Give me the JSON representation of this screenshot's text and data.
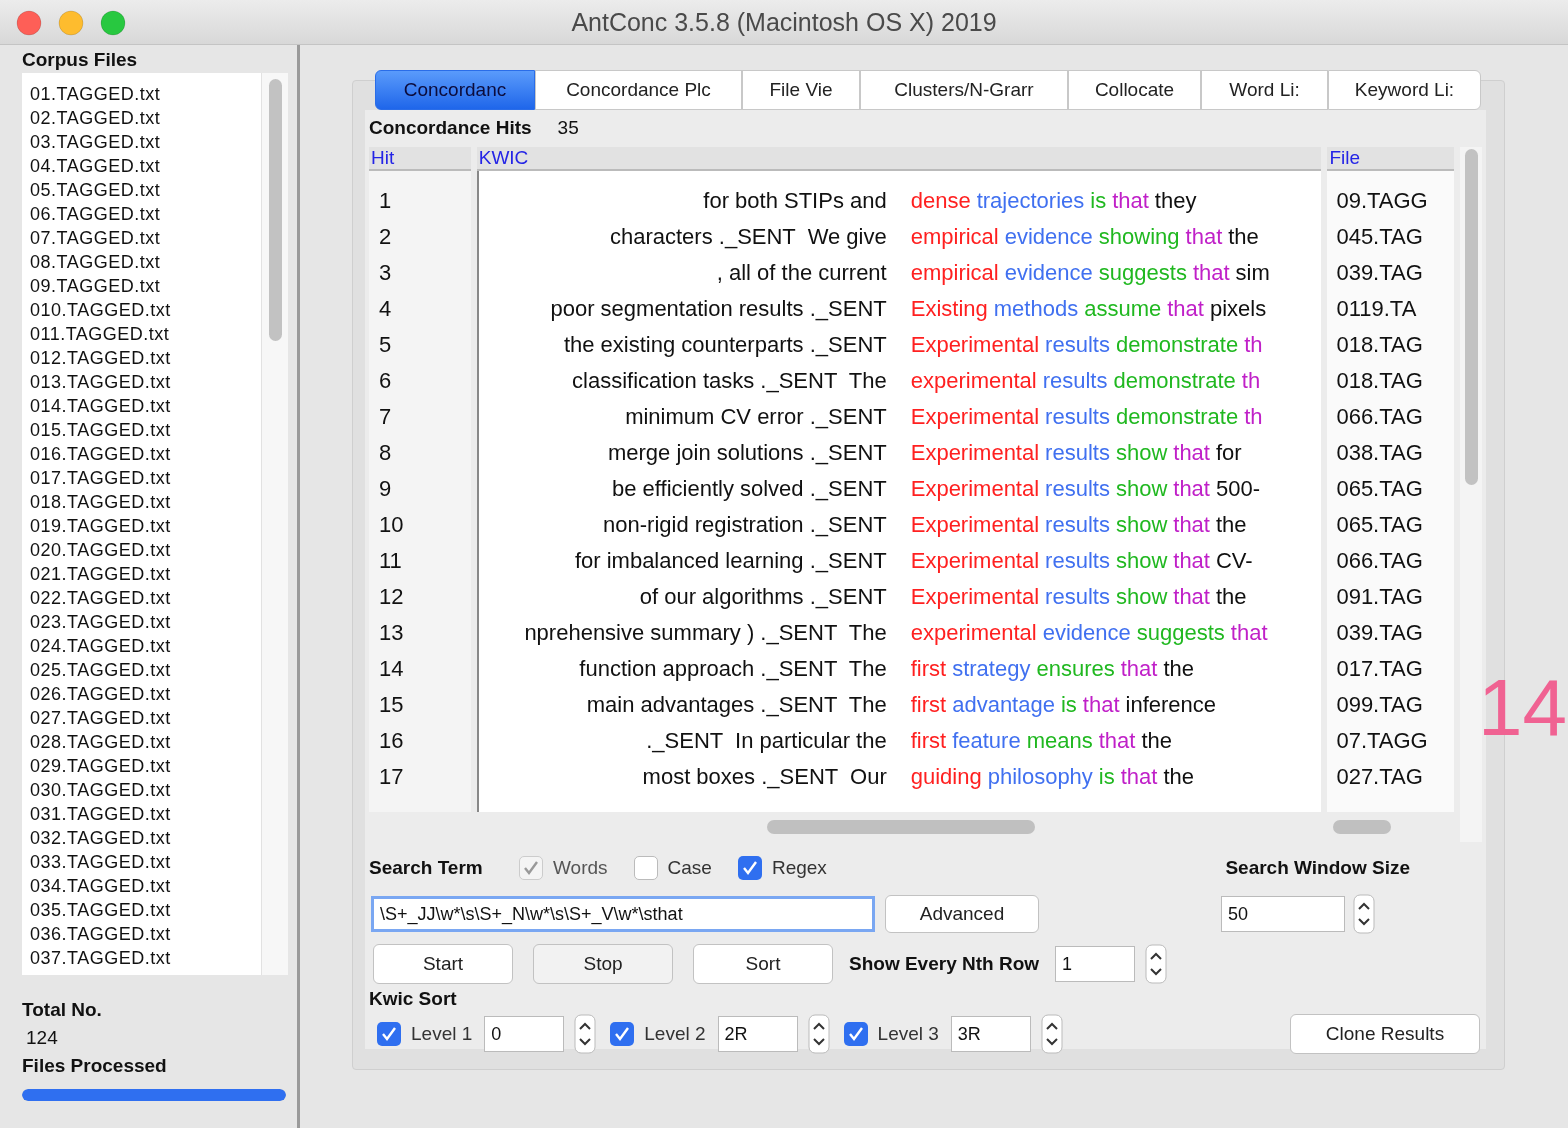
{
  "window": {
    "title": "AntConc 3.5.8 (Macintosh OS X) 2019"
  },
  "corpus_files": {
    "heading": "Corpus Files",
    "files": [
      "01.TAGGED.txt",
      "02.TAGGED.txt",
      "03.TAGGED.txt",
      "04.TAGGED.txt",
      "05.TAGGED.txt",
      "06.TAGGED.txt",
      "07.TAGGED.txt",
      "08.TAGGED.txt",
      "09.TAGGED.txt",
      "010.TAGGED.txt",
      "011.TAGGED.txt",
      "012.TAGGED.txt",
      "013.TAGGED.txt",
      "014.TAGGED.txt",
      "015.TAGGED.txt",
      "016.TAGGED.txt",
      "017.TAGGED.txt",
      "018.TAGGED.txt",
      "019.TAGGED.txt",
      "020.TAGGED.txt",
      "021.TAGGED.txt",
      "022.TAGGED.txt",
      "023.TAGGED.txt",
      "024.TAGGED.txt",
      "025.TAGGED.txt",
      "026.TAGGED.txt",
      "027.TAGGED.txt",
      "028.TAGGED.txt",
      "029.TAGGED.txt",
      "030.TAGGED.txt",
      "031.TAGGED.txt",
      "032.TAGGED.txt",
      "033.TAGGED.txt",
      "034.TAGGED.txt",
      "035.TAGGED.txt",
      "036.TAGGED.txt",
      "037.TAGGED.txt"
    ],
    "total_label": "Total No.",
    "total": "124",
    "processed_label": "Files Processed",
    "progress": {
      "level": 1
    }
  },
  "tabs": [
    {
      "label": "Concordanc",
      "selected": true
    },
    {
      "label": "Concordance Plc",
      "selected": false
    },
    {
      "label": "File Vie",
      "selected": false
    },
    {
      "label": "Clusters/N-Grarr",
      "selected": false
    },
    {
      "label": "Collocate",
      "selected": false
    },
    {
      "label": "Word Li:",
      "selected": false
    },
    {
      "label": "Keyword Li:",
      "selected": false
    }
  ],
  "hits": {
    "label": "Concordance Hits",
    "count": "35"
  },
  "table": {
    "columns": [
      "Hit",
      "KWIC",
      "File"
    ],
    "rows": [
      {
        "hit": "1",
        "left": "for both STIPs and",
        "right": [
          {
            "text": "dense",
            "color": "#ff2020"
          },
          {
            "text": "trajectories",
            "color": "#4070f0"
          },
          {
            "text": "is",
            "color": "#20b820"
          },
          {
            "text": "that",
            "color": "#c020c8"
          },
          {
            "text": "they",
            "color": "#101010"
          }
        ],
        "file": "09.TAGG"
      },
      {
        "hit": "2",
        "left": "characters ._SENT  We give",
        "right": [
          {
            "text": "empirical",
            "color": "#ff2020"
          },
          {
            "text": "evidence",
            "color": "#4070f0"
          },
          {
            "text": "showing",
            "color": "#20b820"
          },
          {
            "text": "that",
            "color": "#c020c8"
          },
          {
            "text": "the",
            "color": "#101010"
          }
        ],
        "file": "045.TAG"
      },
      {
        "hit": "3",
        "left": ", all of the current",
        "right": [
          {
            "text": "empirical",
            "color": "#ff2020"
          },
          {
            "text": "evidence",
            "color": "#4070f0"
          },
          {
            "text": "suggests",
            "color": "#20b820"
          },
          {
            "text": "that",
            "color": "#c020c8"
          },
          {
            "text": "sim",
            "color": "#101010"
          }
        ],
        "file": "039.TAG"
      },
      {
        "hit": "4",
        "left": "poor segmentation results ._SENT",
        "right": [
          {
            "text": "Existing",
            "color": "#ff2020"
          },
          {
            "text": "methods",
            "color": "#4070f0"
          },
          {
            "text": "assume",
            "color": "#20b820"
          },
          {
            "text": "that",
            "color": "#c020c8"
          },
          {
            "text": "pixels",
            "color": "#101010"
          }
        ],
        "file": "0119.TA"
      },
      {
        "hit": "5",
        "left": "the existing counterparts ._SENT",
        "right": [
          {
            "text": "Experimental",
            "color": "#ff2020"
          },
          {
            "text": "results",
            "color": "#4070f0"
          },
          {
            "text": "demonstrate",
            "color": "#20b820"
          },
          {
            "text": "th",
            "color": "#c020c8"
          }
        ],
        "file": "018.TAG"
      },
      {
        "hit": "6",
        "left": "classification tasks ._SENT  The",
        "right": [
          {
            "text": "experimental",
            "color": "#ff2020"
          },
          {
            "text": "results",
            "color": "#4070f0"
          },
          {
            "text": "demonstrate",
            "color": "#20b820"
          },
          {
            "text": "th",
            "color": "#c020c8"
          }
        ],
        "file": "018.TAG"
      },
      {
        "hit": "7",
        "left": "minimum CV error ._SENT",
        "right": [
          {
            "text": "Experimental",
            "color": "#ff2020"
          },
          {
            "text": "results",
            "color": "#4070f0"
          },
          {
            "text": "demonstrate",
            "color": "#20b820"
          },
          {
            "text": "th",
            "color": "#c020c8"
          }
        ],
        "file": "066.TAG"
      },
      {
        "hit": "8",
        "left": "merge join solutions ._SENT",
        "right": [
          {
            "text": "Experimental",
            "color": "#ff2020"
          },
          {
            "text": "results",
            "color": "#4070f0"
          },
          {
            "text": "show",
            "color": "#20b820"
          },
          {
            "text": "that",
            "color": "#c020c8"
          },
          {
            "text": "for",
            "color": "#101010"
          }
        ],
        "file": "038.TAG"
      },
      {
        "hit": "9",
        "left": "be efficiently solved ._SENT",
        "right": [
          {
            "text": "Experimental",
            "color": "#ff2020"
          },
          {
            "text": "results",
            "color": "#4070f0"
          },
          {
            "text": "show",
            "color": "#20b820"
          },
          {
            "text": "that",
            "color": "#c020c8"
          },
          {
            "text": "500-",
            "color": "#101010"
          }
        ],
        "file": "065.TAG"
      },
      {
        "hit": "10",
        "left": "non-rigid registration ._SENT",
        "right": [
          {
            "text": "Experimental",
            "color": "#ff2020"
          },
          {
            "text": "results",
            "color": "#4070f0"
          },
          {
            "text": "show",
            "color": "#20b820"
          },
          {
            "text": "that",
            "color": "#c020c8"
          },
          {
            "text": "the",
            "color": "#101010"
          }
        ],
        "file": "065.TAG"
      },
      {
        "hit": "11",
        "left": "for imbalanced learning ._SENT",
        "right": [
          {
            "text": "Experimental",
            "color": "#ff2020"
          },
          {
            "text": "results",
            "color": "#4070f0"
          },
          {
            "text": "show",
            "color": "#20b820"
          },
          {
            "text": "that",
            "color": "#c020c8"
          },
          {
            "text": "CV-",
            "color": "#101010"
          }
        ],
        "file": "066.TAG"
      },
      {
        "hit": "12",
        "left": "of our algorithms ._SENT",
        "right": [
          {
            "text": "Experimental",
            "color": "#ff2020"
          },
          {
            "text": "results",
            "color": "#4070f0"
          },
          {
            "text": "show",
            "color": "#20b820"
          },
          {
            "text": "that",
            "color": "#c020c8"
          },
          {
            "text": "the",
            "color": "#101010"
          }
        ],
        "file": "091.TAG"
      },
      {
        "hit": "13",
        "left": "nprehensive summary ) ._SENT  The",
        "right": [
          {
            "text": "experimental",
            "color": "#ff2020"
          },
          {
            "text": "evidence",
            "color": "#4070f0"
          },
          {
            "text": "suggests",
            "color": "#20b820"
          },
          {
            "text": "that",
            "color": "#c020c8"
          }
        ],
        "file": "039.TAG"
      },
      {
        "hit": "14",
        "left": "function approach ._SENT  The",
        "right": [
          {
            "text": "first",
            "color": "#ff2020"
          },
          {
            "text": "strategy",
            "color": "#4070f0"
          },
          {
            "text": "ensures",
            "color": "#20b820"
          },
          {
            "text": "that",
            "color": "#c020c8"
          },
          {
            "text": "the",
            "color": "#101010"
          }
        ],
        "file": "017.TAG"
      },
      {
        "hit": "15",
        "left": "main advantages ._SENT  The",
        "right": [
          {
            "text": "first",
            "color": "#ff2020"
          },
          {
            "text": "advantage",
            "color": "#4070f0"
          },
          {
            "text": "is",
            "color": "#20b820"
          },
          {
            "text": "that",
            "color": "#c020c8"
          },
          {
            "text": "inference",
            "color": "#101010"
          }
        ],
        "file": "099.TAG"
      },
      {
        "hit": "16",
        "left": "._SENT  In particular the",
        "right": [
          {
            "text": "first",
            "color": "#ff2020"
          },
          {
            "text": "feature",
            "color": "#4070f0"
          },
          {
            "text": "means",
            "color": "#20b820"
          },
          {
            "text": "that",
            "color": "#c020c8"
          },
          {
            "text": "the",
            "color": "#101010"
          }
        ],
        "file": "07.TAGG"
      },
      {
        "hit": "17",
        "left": "most boxes ._SENT  Our",
        "right": [
          {
            "text": "guiding",
            "color": "#ff2020"
          },
          {
            "text": "philosophy",
            "color": "#4070f0"
          },
          {
            "text": "is",
            "color": "#20b820"
          },
          {
            "text": "that",
            "color": "#c020c8"
          },
          {
            "text": "the",
            "color": "#101010"
          }
        ],
        "file": "027.TAG"
      }
    ]
  },
  "search": {
    "label": "Search Term",
    "options": [
      {
        "label": "Words",
        "checked": true,
        "disabled": true
      },
      {
        "label": "Case",
        "checked": false,
        "disabled": false
      },
      {
        "label": "Regex",
        "checked": true,
        "disabled": false
      }
    ],
    "value": "\\S+_JJ\\w*\\s\\S+_N\\w*\\s\\S+_V\\w*\\sthat",
    "advanced": "Advanced"
  },
  "window_size": {
    "label": "Search Window Size",
    "value": "50"
  },
  "buttons": [
    {
      "label": "Start",
      "disabled": false
    },
    {
      "label": "Stop",
      "disabled": true
    },
    {
      "label": "Sort",
      "disabled": false
    }
  ],
  "nth_row": {
    "label": "Show Every Nth Row",
    "value": "1"
  },
  "kwic_sort": {
    "label": "Kwic Sort",
    "levels": [
      {
        "label": "Level 1",
        "checked": true,
        "value": "0"
      },
      {
        "label": "Level 2",
        "checked": true,
        "value": "2R"
      },
      {
        "label": "Level 3",
        "checked": true,
        "value": "3R"
      }
    ]
  },
  "clone_button": "Clone Results",
  "page_mark": "14"
}
